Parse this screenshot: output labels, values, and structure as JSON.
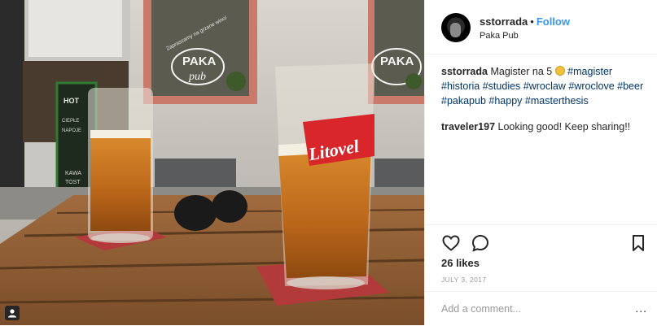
{
  "post": {
    "username": "sstorrada",
    "separator": "•",
    "follow_label": "Follow",
    "location": "Paka Pub",
    "caption": {
      "text_before": "Magister na 5",
      "emoji_icon": "grinning-face-icon",
      "hashtags": [
        "#magister",
        "#historia",
        "#studies",
        "#wroclaw",
        "#wroclove",
        "#beer",
        "#pakapub",
        "#happy",
        "#masterthesis"
      ]
    },
    "comments": [
      {
        "username": "traveler197",
        "text": "Looking good! Keep sharing!!"
      }
    ],
    "likes": "26 likes",
    "date": "JULY 3, 2017",
    "add_comment_placeholder": "Add a comment...",
    "more_options": "..."
  },
  "photo": {
    "glass_brand": "Litovel",
    "window_text": "PAKA",
    "window_text_2": "pub",
    "window_sign": "Zapraszamy na grzane wino!",
    "board_text": [
      "HOT",
      "CIEPŁE",
      "NAPOJE",
      "KAWA",
      "TOST"
    ],
    "tag_icon": "person-tag-icon"
  },
  "icons": {
    "like": "heart-icon",
    "comment": "speech-bubble-icon",
    "save": "bookmark-icon"
  },
  "colors": {
    "link_blue": "#3897f0",
    "hashtag_blue": "#003569",
    "meta_grey": "#999999",
    "border": "#efefef"
  }
}
